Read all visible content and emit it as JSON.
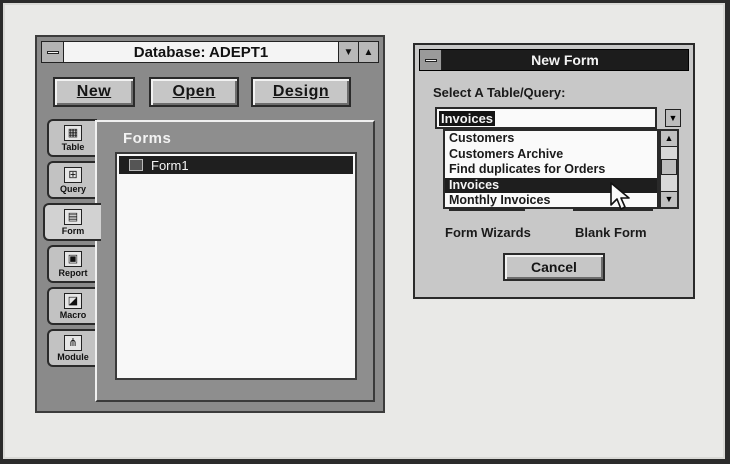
{
  "database_window": {
    "title": "Database: ADEPT1",
    "buttons": {
      "new": "New",
      "open": "Open",
      "design": "Design"
    },
    "tabs": [
      {
        "label": "Table",
        "icon": "table-icon",
        "glyph": "▦"
      },
      {
        "label": "Query",
        "icon": "query-icon",
        "glyph": "⊞"
      },
      {
        "label": "Form",
        "icon": "form-icon",
        "glyph": "▤"
      },
      {
        "label": "Report",
        "icon": "report-icon",
        "glyph": "▣"
      },
      {
        "label": "Macro",
        "icon": "macro-icon",
        "glyph": "◪"
      },
      {
        "label": "Module",
        "icon": "module-icon",
        "glyph": "⋔"
      }
    ],
    "active_tab": "Form",
    "panel_label": "Forms",
    "items": [
      "Form1"
    ]
  },
  "new_form_dialog": {
    "title": "New Form",
    "select_label": "Select A Table/Query:",
    "input_value": "Invoices",
    "list_items": [
      "Customers",
      "Customers Archive",
      "Find duplicates for Orders",
      "Invoices",
      "Monthly Invoices"
    ],
    "selected_item": "Invoices",
    "form_wizards_label": "Form Wizards",
    "blank_form_label": "Blank Form",
    "cancel_label": "Cancel"
  }
}
